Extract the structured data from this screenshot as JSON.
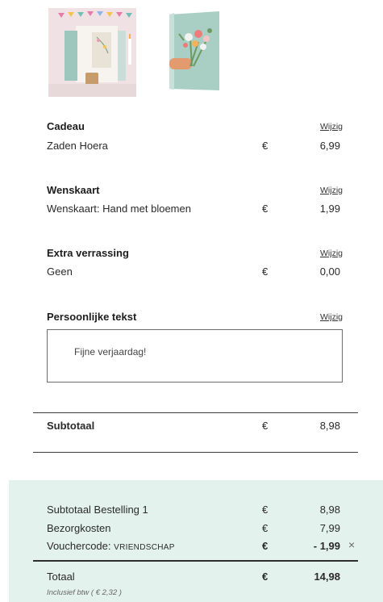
{
  "images": {
    "gift_product": {
      "icon": "seed-gift-box-photo"
    },
    "greeting_card": {
      "icon": "bouquet-card-illustration"
    }
  },
  "sections": {
    "cadeau": {
      "title": "Cadeau",
      "edit": "Wijzig",
      "item": "Zaden Hoera",
      "currency": "€",
      "price": "6,99"
    },
    "wenskaart": {
      "title": "Wenskaart",
      "edit": "Wijzig",
      "item": "Wenskaart: Hand met bloemen",
      "currency": "€",
      "price": "1,99"
    },
    "extra": {
      "title": "Extra verrassing",
      "edit": "Wijzig",
      "item": "Geen",
      "currency": "€",
      "price": "0,00"
    },
    "text": {
      "title": "Persoonlijke tekst",
      "edit": "Wijzig",
      "value": "Fijne verjaardag!"
    }
  },
  "subtotal": {
    "label": "Subtotaal",
    "currency": "€",
    "value": "8,98"
  },
  "summary": {
    "subtotal_order": {
      "label": "Subtotaal Bestelling 1",
      "currency": "€",
      "value": "8,98"
    },
    "shipping": {
      "label": "Bezorgkosten",
      "currency": "€",
      "value": "7,99"
    },
    "voucher": {
      "label": "Vouchercode:",
      "code": "VRIENDSCHAP",
      "currency": "€",
      "value": "- 1,99",
      "remove": "×"
    },
    "total": {
      "label": "Totaal",
      "currency": "€",
      "value": "14,98",
      "vat_note": "Inclusief btw ( € 2,32 )"
    }
  },
  "colors": {
    "summary_bg": "#e4f2ee",
    "divider": "#3a3a3a"
  }
}
